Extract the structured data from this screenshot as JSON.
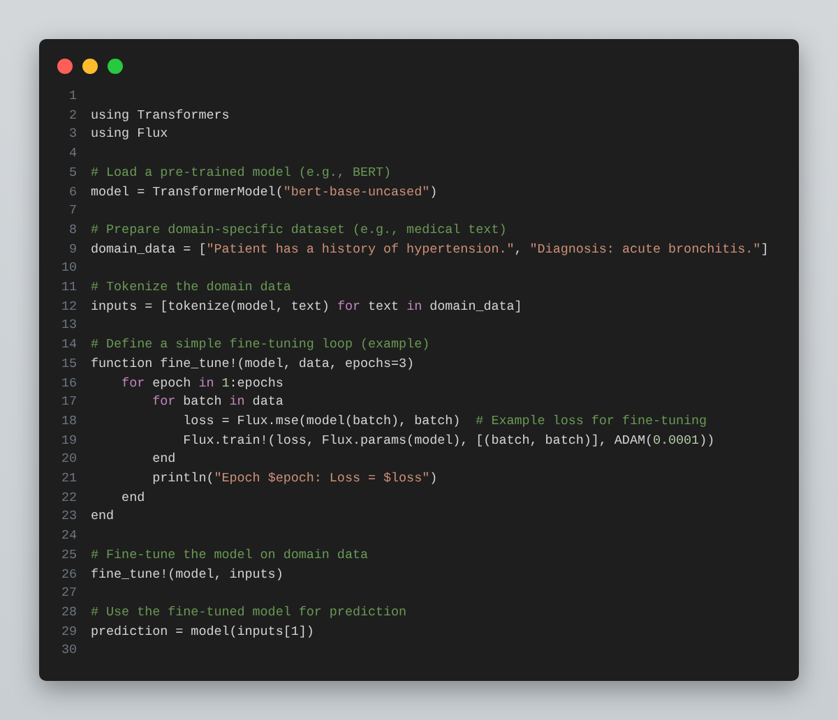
{
  "window": {
    "controls": [
      {
        "color": "#ff5f56"
      },
      {
        "color": "#ffbd2e"
      },
      {
        "color": "#27c93f"
      }
    ]
  },
  "lines": [
    {
      "number": "1"
    },
    {
      "number": "2",
      "tokens": [
        {
          "kind": "plain",
          "text": "using Transformers"
        }
      ]
    },
    {
      "number": "3",
      "tokens": [
        {
          "kind": "plain",
          "text": "using Flux"
        }
      ]
    },
    {
      "number": "4"
    },
    {
      "number": "5",
      "tokens": [
        {
          "kind": "comment",
          "text": "# Load a pre-trained model (e.g., BERT)"
        }
      ]
    },
    {
      "number": "6",
      "tokens": [
        {
          "kind": "plain",
          "text": "model = TransformerModel("
        },
        {
          "kind": "string",
          "text": "\"bert-base-uncased\""
        },
        {
          "kind": "plain",
          "text": ")"
        }
      ]
    },
    {
      "number": "7"
    },
    {
      "number": "8",
      "tokens": [
        {
          "kind": "comment",
          "text": "# Prepare domain-specific dataset (e.g., medical text)"
        }
      ]
    },
    {
      "number": "9",
      "tokens": [
        {
          "kind": "plain",
          "text": "domain_data = ["
        },
        {
          "kind": "string",
          "text": "\"Patient has a history of hypertension.\""
        },
        {
          "kind": "plain",
          "text": ", "
        },
        {
          "kind": "string",
          "text": "\"Diagnosis: acute bronchitis.\""
        },
        {
          "kind": "plain",
          "text": "]"
        }
      ]
    },
    {
      "number": "10"
    },
    {
      "number": "11",
      "tokens": [
        {
          "kind": "comment",
          "text": "# Tokenize the domain data"
        }
      ]
    },
    {
      "number": "12",
      "tokens": [
        {
          "kind": "plain",
          "text": "inputs = [tokenize(model, text) "
        },
        {
          "kind": "keyword",
          "text": "for"
        },
        {
          "kind": "plain",
          "text": " text "
        },
        {
          "kind": "keyword",
          "text": "in"
        },
        {
          "kind": "plain",
          "text": " domain_data]"
        }
      ]
    },
    {
      "number": "13"
    },
    {
      "number": "14",
      "tokens": [
        {
          "kind": "comment",
          "text": "# Define a simple fine-tuning loop (example)"
        }
      ]
    },
    {
      "number": "15",
      "tokens": [
        {
          "kind": "plain",
          "text": "function fine_tune!(model, data, epochs=3)"
        }
      ]
    },
    {
      "number": "16",
      "tokens": [
        {
          "kind": "keyword",
          "text": "    for"
        },
        {
          "kind": "plain",
          "text": " epoch "
        },
        {
          "kind": "keyword",
          "text": "in"
        },
        {
          "kind": "number",
          "text": " 1"
        },
        {
          "kind": "plain",
          "text": ":epochs"
        }
      ]
    },
    {
      "number": "17",
      "tokens": [
        {
          "kind": "keyword",
          "text": "        for"
        },
        {
          "kind": "plain",
          "text": " batch "
        },
        {
          "kind": "keyword",
          "text": "in"
        },
        {
          "kind": "plain",
          "text": " data"
        }
      ]
    },
    {
      "number": "18",
      "tokens": [
        {
          "kind": "plain",
          "text": "            loss = Flux.mse(model(batch), batch)  "
        },
        {
          "kind": "comment",
          "text": "# Example loss for fine-tuning"
        }
      ]
    },
    {
      "number": "19",
      "tokens": [
        {
          "kind": "plain",
          "text": "            Flux.train!(loss, Flux.params(model), [(batch, batch)], ADAM("
        },
        {
          "kind": "number",
          "text": "0.0001"
        },
        {
          "kind": "plain",
          "text": "))"
        }
      ]
    },
    {
      "number": "20",
      "tokens": [
        {
          "kind": "plain",
          "text": "        end"
        }
      ]
    },
    {
      "number": "21",
      "tokens": [
        {
          "kind": "plain",
          "text": "        println("
        },
        {
          "kind": "string",
          "text": "\"Epoch $epoch: Loss = $loss\""
        },
        {
          "kind": "plain",
          "text": ")"
        }
      ]
    },
    {
      "number": "22",
      "tokens": [
        {
          "kind": "plain",
          "text": "    end"
        }
      ]
    },
    {
      "number": "23",
      "tokens": [
        {
          "kind": "plain",
          "text": "end"
        }
      ]
    },
    {
      "number": "24"
    },
    {
      "number": "25",
      "tokens": [
        {
          "kind": "comment",
          "text": "# Fine-tune the model on domain data"
        }
      ]
    },
    {
      "number": "26",
      "tokens": [
        {
          "kind": "plain",
          "text": "fine_tune!(model, inputs)"
        }
      ]
    },
    {
      "number": "27"
    },
    {
      "number": "28",
      "tokens": [
        {
          "kind": "comment",
          "text": "# Use the fine-tuned model for prediction"
        }
      ]
    },
    {
      "number": "29",
      "tokens": [
        {
          "kind": "plain",
          "text": "prediction = model(inputs[1])"
        }
      ]
    },
    {
      "number": "30"
    }
  ]
}
